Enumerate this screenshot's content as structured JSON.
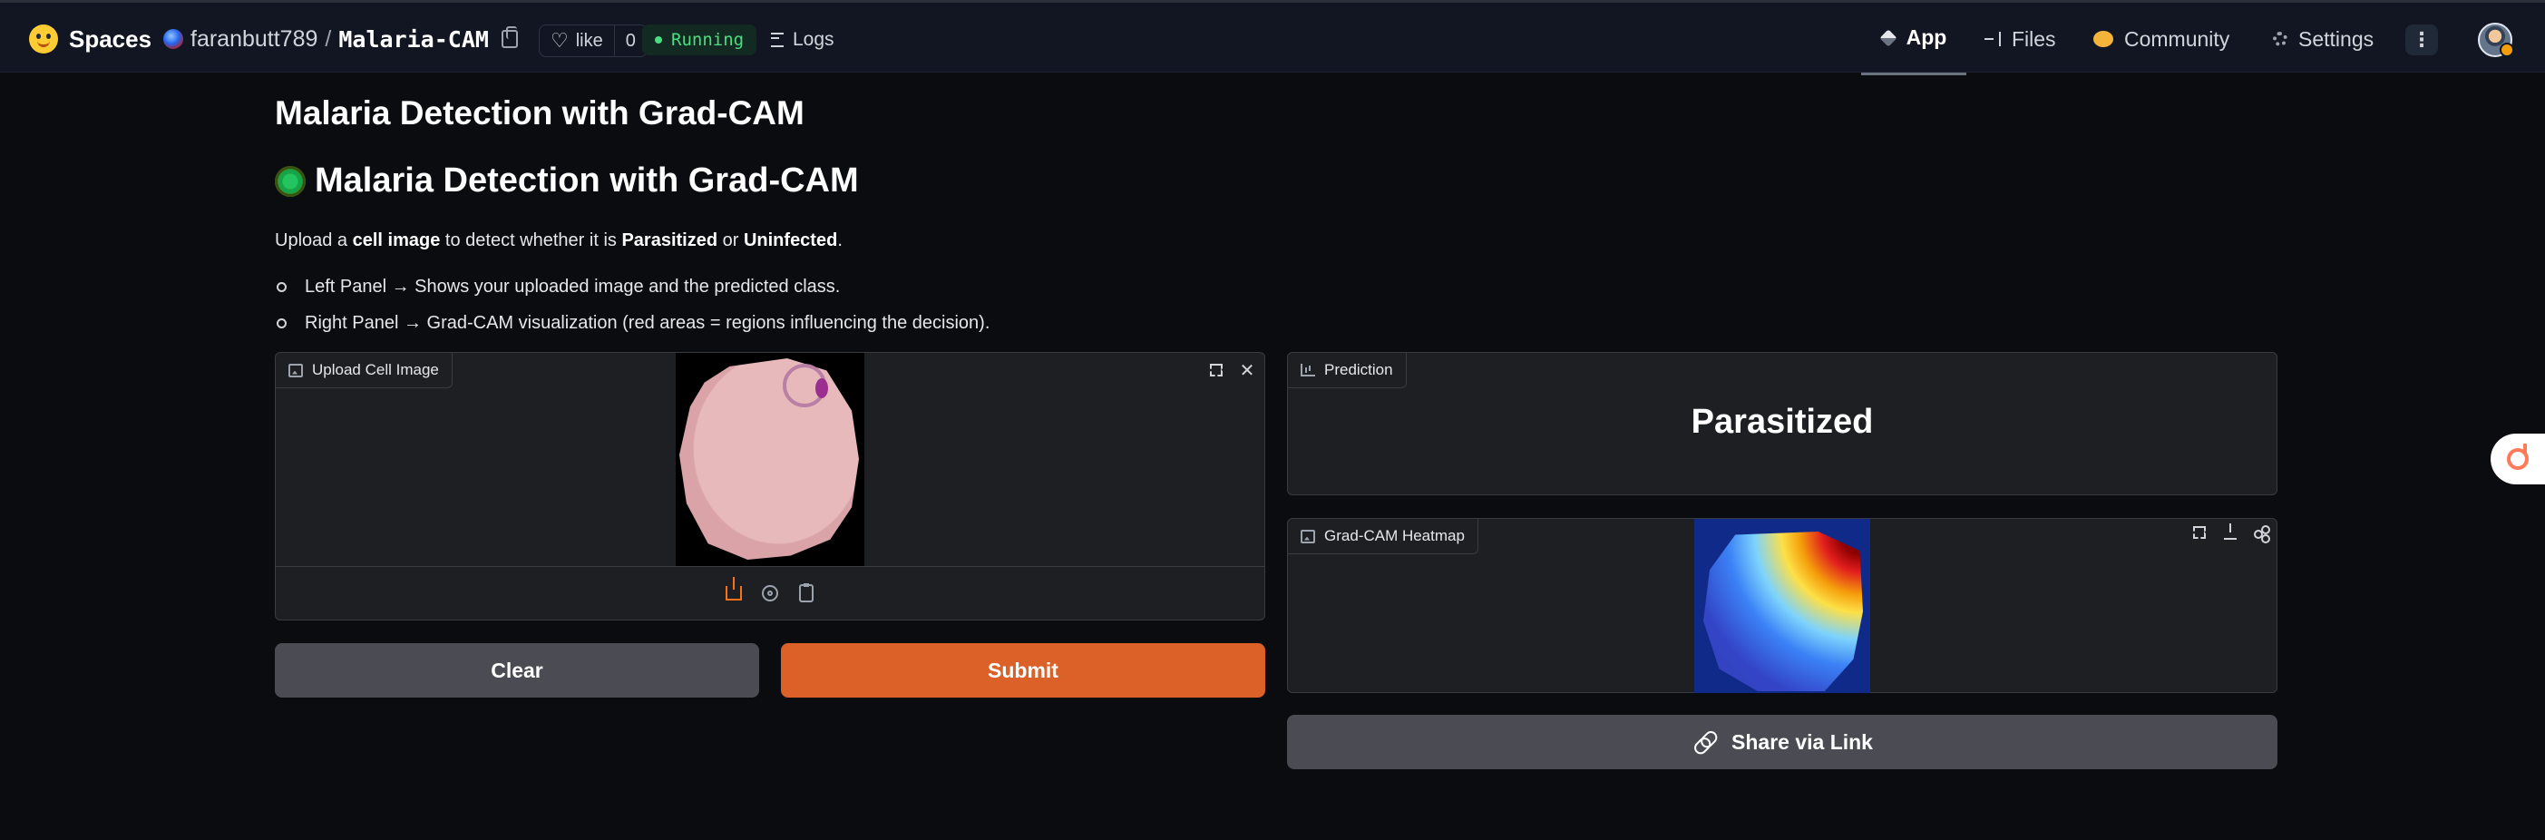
{
  "nav": {
    "brand": "Spaces",
    "owner": "faranbutt789",
    "slash": "/",
    "repo_name": "Malaria-CAM",
    "like_label": "like",
    "like_count": "0",
    "status": "Running",
    "logs_label": "Logs",
    "tabs": [
      {
        "label": "App",
        "icon": "cube-icon",
        "active": true
      },
      {
        "label": "Files",
        "icon": "files-icon",
        "active": false
      },
      {
        "label": "Community",
        "icon": "community-icon",
        "active": false
      },
      {
        "label": "Settings",
        "icon": "gear-icon",
        "active": false
      }
    ],
    "more_label": "⋮"
  },
  "content": {
    "title": "Malaria Detection with Grad-CAM",
    "heading": "Malaria Detection with Grad-CAM",
    "desc": {
      "pre": "Upload a ",
      "b1": "cell image",
      "mid1": " to detect whether it is ",
      "b2": "Parasitized",
      "mid2": " or ",
      "b3": "Uninfected",
      "post": "."
    },
    "bullets": [
      "Left Panel → Shows your uploaded image and the predicted class.",
      "Right Panel → Grad-CAM visualization (red areas = regions influencing the decision)."
    ]
  },
  "upload": {
    "label": "Upload Cell Image",
    "close_symbol": "✕"
  },
  "buttons": {
    "clear": "Clear",
    "submit": "Submit",
    "share": "Share via Link"
  },
  "prediction": {
    "label": "Prediction",
    "value": "Parasitized"
  },
  "heatmap": {
    "label": "Grad-CAM Heatmap"
  },
  "colors": {
    "accent": "#dc6128",
    "status_green": "#4ade80",
    "panel_bg": "#1e1f22"
  }
}
